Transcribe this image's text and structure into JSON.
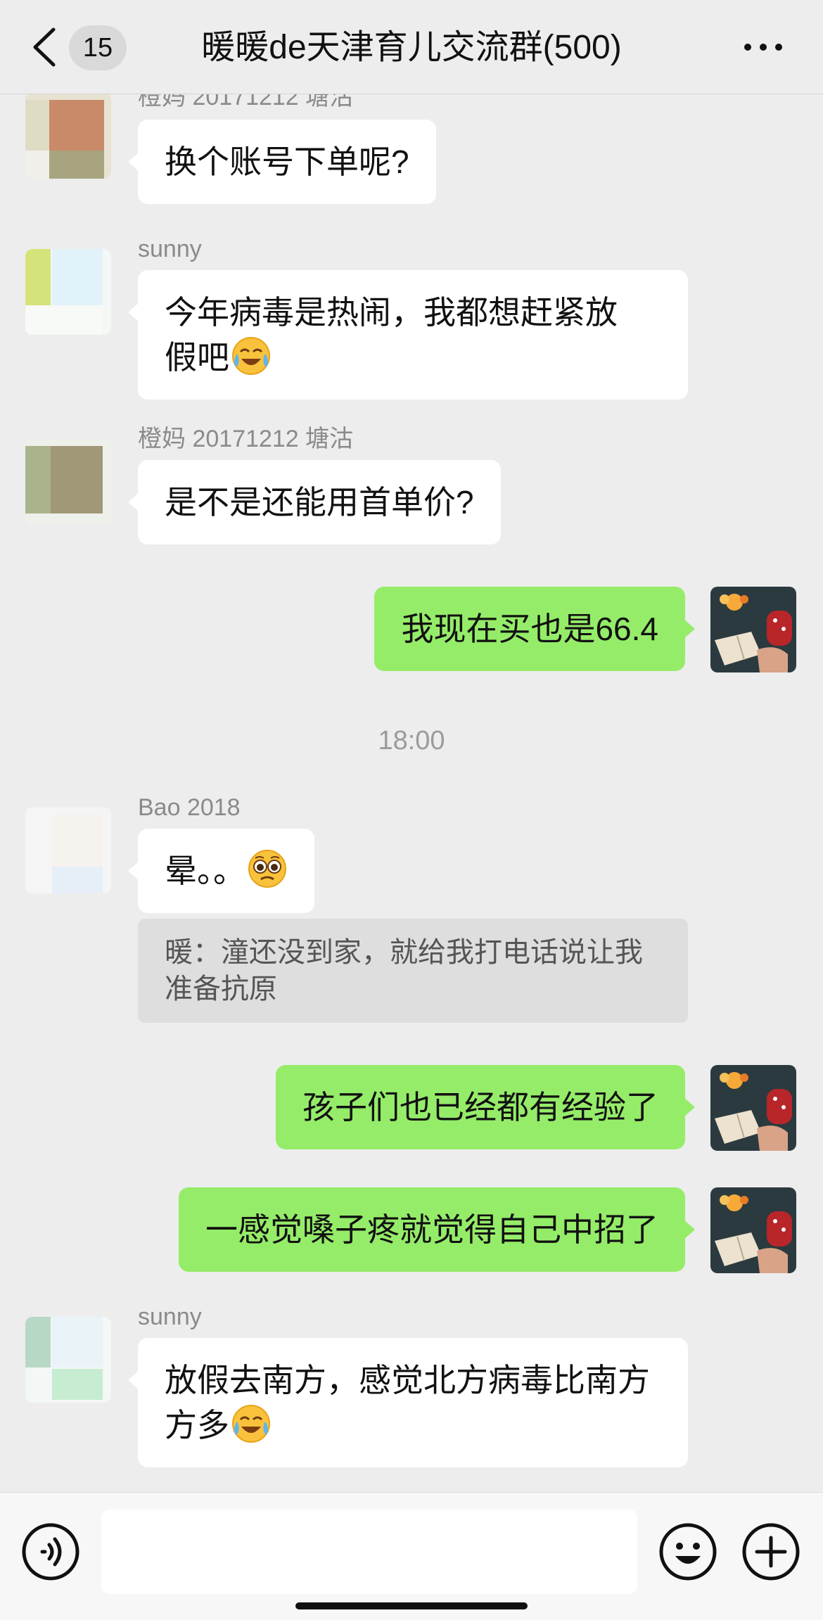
{
  "header": {
    "unread_count": "15",
    "title": "暖暖de天津育儿交流群(500)"
  },
  "messages": [
    {
      "sender": "橙妈 20171212 塘沽",
      "text": "换个账号下单呢?"
    },
    {
      "sender": "sunny",
      "text": "今年病毒是热闹，我都想赶紧放假吧",
      "emoji": "crying-laughing-emoji"
    },
    {
      "sender": "橙妈 20171212 塘沽",
      "text": "是不是还能用首单价?"
    },
    {
      "text": "我现在买也是66.4"
    },
    {
      "timestamp": "18:00"
    },
    {
      "sender": "Bao 2018",
      "text": "晕。。",
      "emoji": "pleading-face-emoji",
      "quote": "暖：潼还没到家，就给我打电话说让我准备抗原"
    },
    {
      "text": "孩子们也已经都有经验了"
    },
    {
      "text": "一感觉嗓子疼就觉得自己中招了"
    },
    {
      "sender": "sunny",
      "text": "放假去南方，感觉北方病毒比南方多",
      "emoji": "crying-laughing-emoji"
    }
  ],
  "m0": {
    "sender": "橙妈 20171212 塘沽",
    "text": "换个账号下单呢?"
  },
  "m1": {
    "sender": "sunny",
    "line1": "今年病毒是热闹，我都想赶紧放",
    "line2": "假吧"
  },
  "m2": {
    "sender": "橙妈 20171212 塘沽",
    "text": "是不是还能用首单价?"
  },
  "m3": {
    "text": "我现在买也是66.4"
  },
  "time_divider": "18:00",
  "m4": {
    "sender": "Bao 2018",
    "text": "晕。。",
    "quote_line1": "暖：潼还没到家，就给我打电话说让我",
    "quote_line2": "准备抗原"
  },
  "m5": {
    "text": "孩子们也已经都有经验了"
  },
  "m6": {
    "text": "一感觉嗓子疼就觉得自己中招了"
  },
  "m7": {
    "sender": "sunny",
    "line1": "放假去南方，感觉北方病毒比南方",
    "line2": "方多"
  },
  "input": {
    "value": ""
  },
  "colors": {
    "background": "#ededed",
    "incoming_bubble": "#ffffff",
    "outgoing_bubble": "#95ec69",
    "quote_background": "#dedede"
  }
}
